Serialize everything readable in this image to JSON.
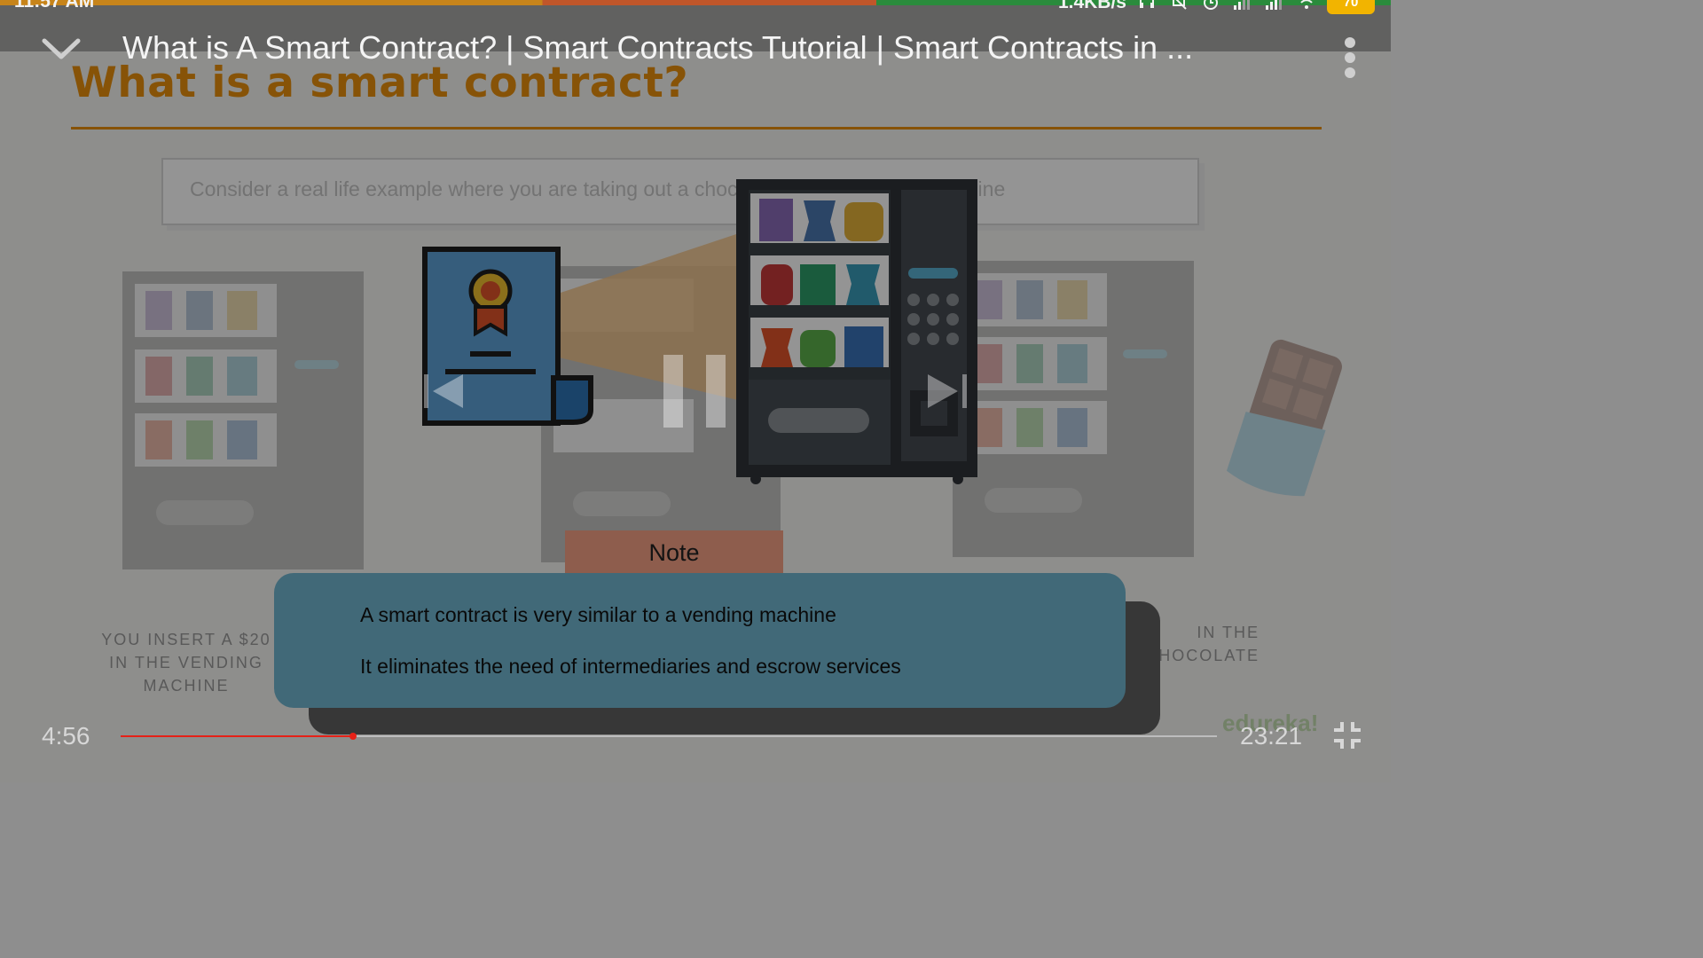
{
  "status_bar": {
    "time": "11:57 AM",
    "net_speed": "1.4KB/s",
    "battery": "70",
    "icons": [
      "headset-icon",
      "mute-icon",
      "alarm-icon",
      "signal-icon",
      "signal-icon",
      "wifi-icon",
      "battery-icon"
    ]
  },
  "player": {
    "title": "What is A Smart Contract? | Smart Contracts Tutorial | Smart Contracts in ...",
    "current_time": "4:56",
    "total_time": "23:21",
    "progress": 0.2117,
    "state": "paused-controls-visible"
  },
  "slide": {
    "title": "What is a smart contract?",
    "prompt": "Consider a real life example where you are taking out a chocolate from a vending machine",
    "caption_left": "YOU INSERT A $20 IN THE VENDING MACHINE",
    "caption_right": "IN THE CHOCOLATE",
    "note_label": "Note",
    "note_lines": [
      "A smart contract is very similar to a vending machine",
      "It eliminates the need of intermediaries and escrow services"
    ]
  },
  "colors": {
    "accent_orange": "#e9900d",
    "seek_red": "#e62117",
    "note_blue": "#71b6cf",
    "note_tab": "#f4a086"
  }
}
